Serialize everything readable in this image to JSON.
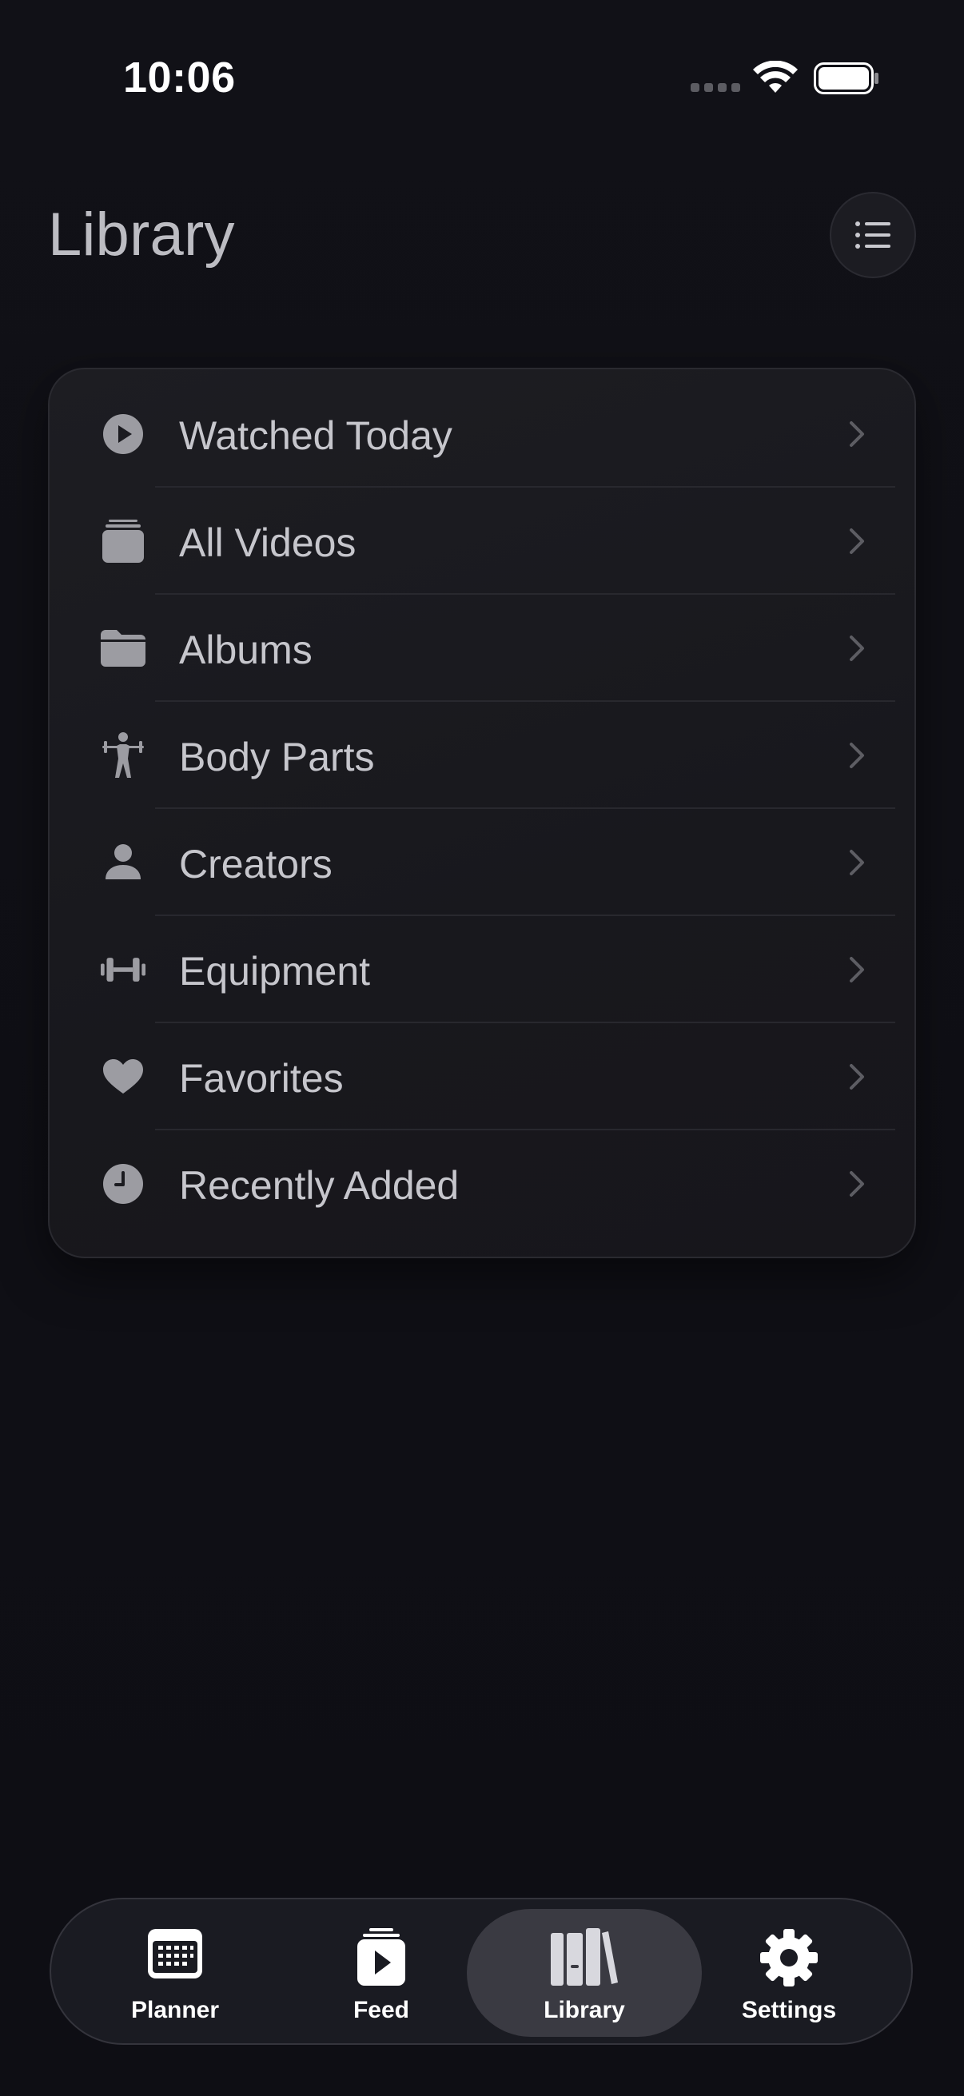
{
  "status_bar": {
    "time": "10:06"
  },
  "header": {
    "title": "Library",
    "menu_icon": "list-icon"
  },
  "library_items": [
    {
      "label": "Watched Today",
      "icon": "play-circle-icon"
    },
    {
      "label": "All Videos",
      "icon": "stack-icon"
    },
    {
      "label": "Albums",
      "icon": "folder-icon"
    },
    {
      "label": "Body Parts",
      "icon": "weightlifter-icon"
    },
    {
      "label": "Creators",
      "icon": "person-icon"
    },
    {
      "label": "Equipment",
      "icon": "dumbbell-icon"
    },
    {
      "label": "Favorites",
      "icon": "heart-icon"
    },
    {
      "label": "Recently Added",
      "icon": "clock-icon"
    }
  ],
  "tab_bar": {
    "tabs": [
      {
        "label": "Planner",
        "icon": "calendar-icon",
        "active": false
      },
      {
        "label": "Feed",
        "icon": "play-stack-icon",
        "active": false
      },
      {
        "label": "Library",
        "icon": "books-icon",
        "active": true
      },
      {
        "label": "Settings",
        "icon": "gear-icon",
        "active": false
      }
    ]
  },
  "colors": {
    "background": "#0f0f15",
    "card": "#1b1b20",
    "icon_gray": "#9c9ca2",
    "label": "#c6c6cc",
    "active_pill": "#3a3a42"
  }
}
